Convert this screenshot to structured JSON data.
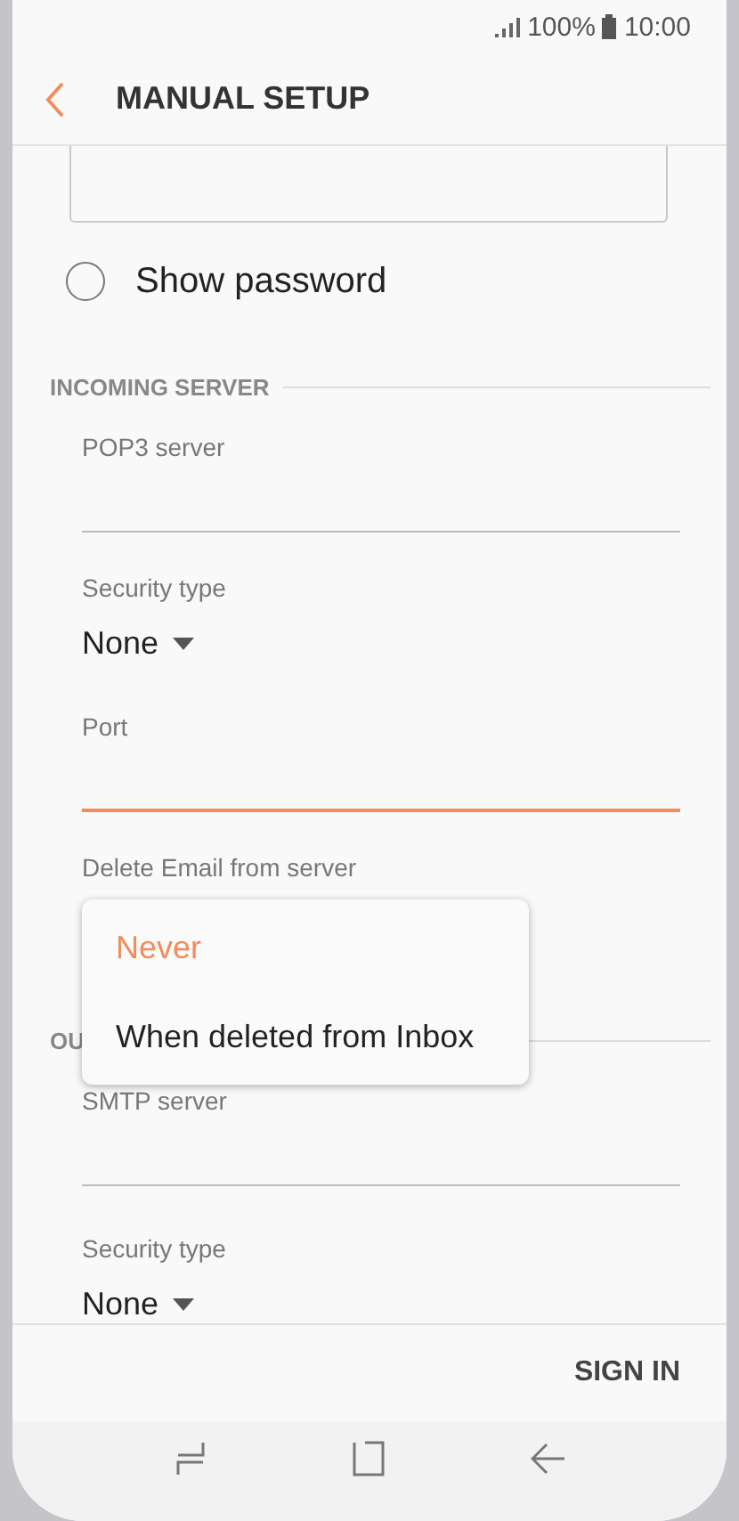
{
  "status_bar": {
    "battery": "100%",
    "time": "10:00"
  },
  "header": {
    "title": "MANUAL SETUP"
  },
  "show_password": {
    "label": "Show password",
    "checked": false
  },
  "sections": [
    {
      "heading": "INCOMING SERVER",
      "fields": [
        {
          "kind": "text",
          "label": "POP3 server",
          "focused": false
        },
        {
          "kind": "select",
          "label": "Security type",
          "value": "None"
        },
        {
          "kind": "text",
          "label": "Port",
          "focused": true
        },
        {
          "kind": "select",
          "label": "Delete Email from server"
        }
      ]
    },
    {
      "heading": "OU",
      "fields": [
        {
          "kind": "text",
          "label": "SMTP server",
          "focused": false
        },
        {
          "kind": "select",
          "label": "Security type",
          "value": "None"
        }
      ]
    }
  ],
  "dropdown": {
    "options": [
      {
        "label": "Never",
        "selected": true
      },
      {
        "label": "When deleted from Inbox",
        "selected": false
      }
    ]
  },
  "footer": {
    "button": "SIGN IN"
  }
}
